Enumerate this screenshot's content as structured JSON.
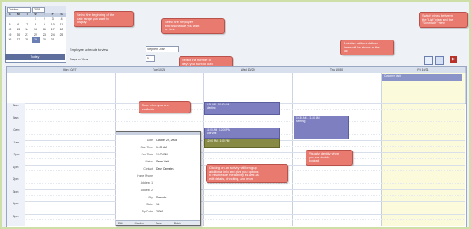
{
  "minical": {
    "month": "October",
    "year": "2008",
    "days_of_week": [
      "S",
      "M",
      "T",
      "W",
      "T",
      "F",
      "S"
    ],
    "weeks": [
      [
        "",
        "",
        "",
        "1",
        "2",
        "3",
        "4"
      ],
      [
        "5",
        "6",
        "7",
        "8",
        "9",
        "10",
        "11"
      ],
      [
        "12",
        "13",
        "14",
        "15",
        "16",
        "17",
        "18"
      ],
      [
        "19",
        "20",
        "21",
        "22",
        "23",
        "24",
        "25"
      ],
      [
        "26",
        "27",
        "28",
        "29",
        "30",
        "31",
        ""
      ]
    ],
    "today_label": "Today"
  },
  "form": {
    "employee_label": "Employee schedule to view",
    "employee_value": "Stephen, Jean",
    "days_label": "Days to View",
    "days_value": "5"
  },
  "callouts": {
    "c1": [
      "Select the beginning of the",
      "date range you want to",
      "display."
    ],
    "c2": [
      "Select the employee",
      "who's schedule you want",
      "to view."
    ],
    "c3": [
      "Select the number of",
      "days you want to load",
      "(please use from 1 to 7)"
    ],
    "c4": [
      "Switch views between",
      "the \"List\" view and the",
      "\"Schedule\" view"
    ],
    "c5": [
      "Activities without defined",
      "times will be shown at the",
      "top"
    ],
    "c6": [
      "Time when you are",
      "available"
    ],
    "c7": [
      "Clicking on an activity will bring up",
      "additional info and give you options",
      "to reschedule the activity as well as",
      "edit details, checking, and more"
    ],
    "c8": [
      "Visually identify when",
      "you are double",
      "booked"
    ]
  },
  "days": [
    "Mon 10/27",
    "Tue 10/28",
    "Wed 10/29",
    "Thu 10/30",
    "Fri 10/31"
  ],
  "times": [
    "8am",
    "9am",
    "10am",
    "11am",
    "12pm",
    "1pm",
    "2pm",
    "3pm",
    "4pm",
    "5pm"
  ],
  "events": {
    "allday": "Customer Visit",
    "wed_am": "9:30 AM - 10:30 AM",
    "wed_am2": "Meeting",
    "wed_mid": "11:00 AM - 12:00 PM",
    "wed_mid2": "Site Visit",
    "wed_olive": "12:00 PM - 1:00 PM",
    "thu_a": "10:30 AM - 11:30 AM",
    "thu_b": "Meeting"
  },
  "popup": {
    "rows": [
      {
        "k": "Date",
        "v": "October 29, 2008"
      },
      {
        "k": "Start Time",
        "v": "11:00 AM"
      },
      {
        "k": "End Time",
        "v": "12:00 PM"
      },
      {
        "k": "Status",
        "v": "Same Visit"
      },
      {
        "k": "Contact",
        "v": "Dave Carnates"
      },
      {
        "k": "Home Phone",
        "v": ""
      },
      {
        "k": "Address 1",
        "v": ""
      },
      {
        "k": "Address 2",
        "v": ""
      },
      {
        "k": "City",
        "v": "Roanoke"
      },
      {
        "k": "State",
        "v": "VA"
      },
      {
        "k": "Zip Code",
        "v": "24001"
      }
    ],
    "actions": [
      "Edit",
      "Check In",
      "Move",
      "Delete"
    ]
  }
}
